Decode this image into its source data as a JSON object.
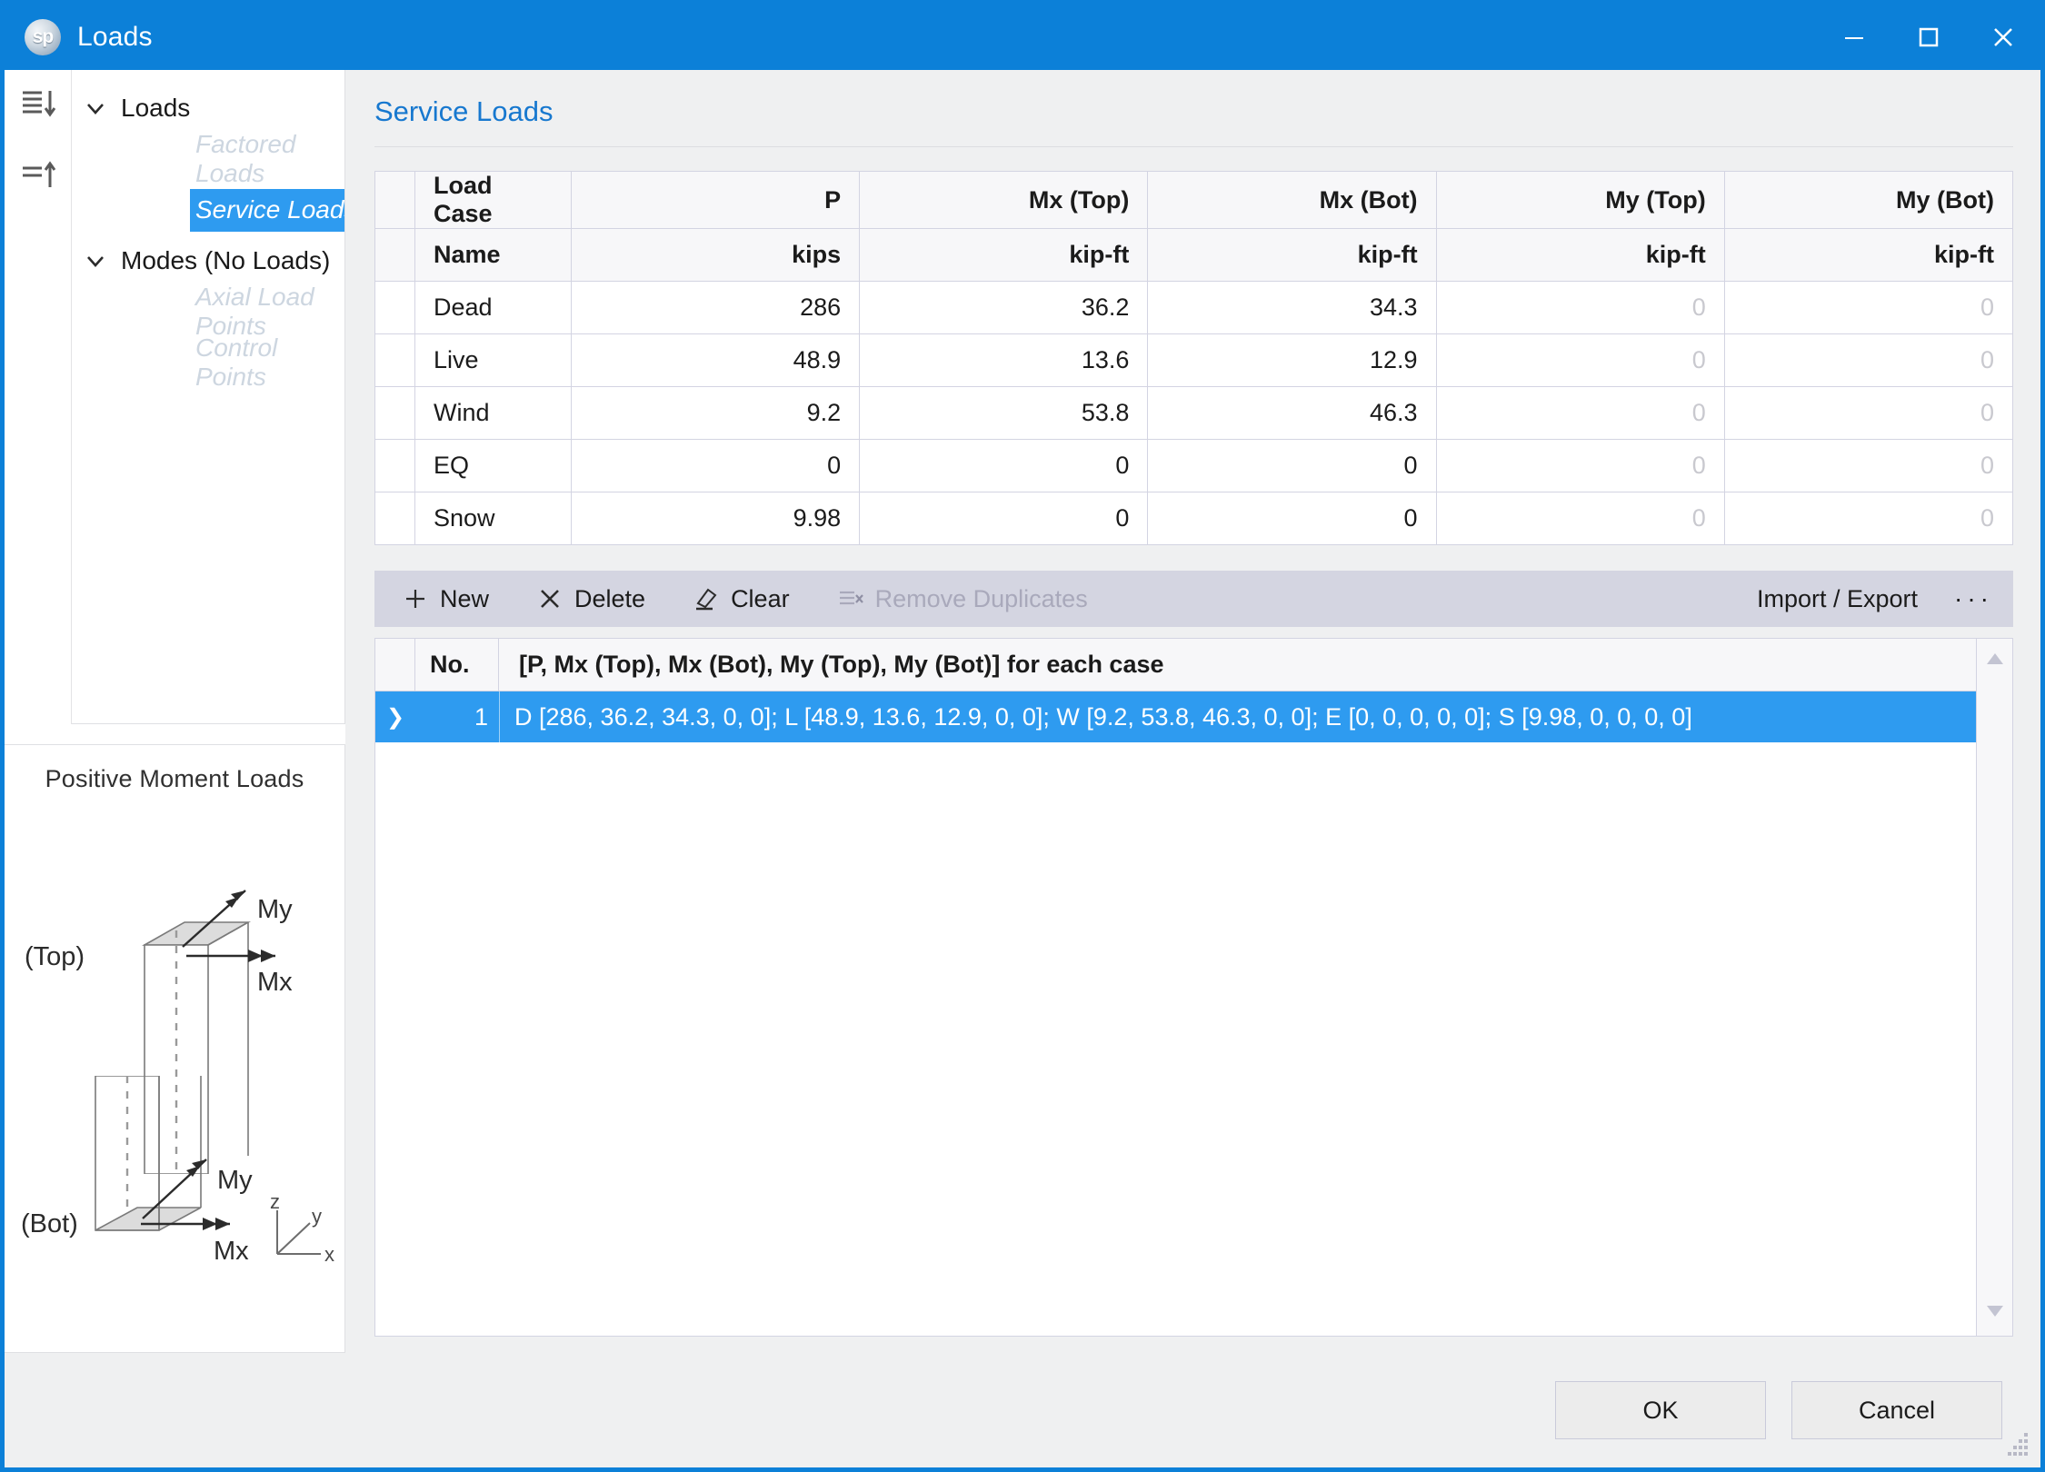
{
  "window": {
    "title": "Loads",
    "logo_text": "sp",
    "controls": {
      "minimize": "minimize-icon",
      "maximize": "maximize-icon",
      "close": "close-icon"
    },
    "accent_color": "#0c80d8",
    "selection_color": "#2e9bf0"
  },
  "sidebar": {
    "gutter": [
      {
        "name": "expand-all-icon"
      },
      {
        "name": "collapse-all-icon"
      }
    ],
    "tree": [
      {
        "label": "Loads",
        "level": 0,
        "expanded": true,
        "selected": false,
        "disabled": false
      },
      {
        "label": "Factored Loads",
        "level": 1,
        "expanded": null,
        "selected": false,
        "disabled": true
      },
      {
        "label": "Service Loads",
        "level": 1,
        "expanded": null,
        "selected": true,
        "disabled": false
      },
      {
        "label": "Modes (No Loads)",
        "level": 0,
        "expanded": true,
        "selected": false,
        "disabled": false
      },
      {
        "label": "Axial Load Points",
        "level": 1,
        "expanded": null,
        "selected": false,
        "disabled": true
      },
      {
        "label": "Control Points",
        "level": 1,
        "expanded": null,
        "selected": false,
        "disabled": true
      }
    ],
    "diagram": {
      "title": "Positive Moment Loads",
      "top_label": "(Top)",
      "bot_label": "(Bot)",
      "top_my": "My",
      "top_mx": "Mx",
      "bot_my": "My",
      "bot_mx": "Mx",
      "axes": {
        "z": "z",
        "y": "y",
        "x": "x"
      }
    }
  },
  "main": {
    "page_title": "Service Loads",
    "table": {
      "headers": [
        "",
        "Load Case",
        "P",
        "Mx (Top)",
        "Mx (Bot)",
        "My (Top)",
        "My (Bot)"
      ],
      "units": [
        "",
        "Name",
        "kips",
        "kip-ft",
        "kip-ft",
        "kip-ft",
        "kip-ft"
      ],
      "rows": [
        {
          "name": "Dead",
          "P": "286",
          "mx_top": "36.2",
          "mx_bot": "34.3",
          "my_top": "0",
          "my_bot": "0"
        },
        {
          "name": "Live",
          "P": "48.9",
          "mx_top": "13.6",
          "mx_bot": "12.9",
          "my_top": "0",
          "my_bot": "0"
        },
        {
          "name": "Wind",
          "P": "9.2",
          "mx_top": "53.8",
          "mx_bot": "46.3",
          "my_top": "0",
          "my_bot": "0"
        },
        {
          "name": "EQ",
          "P": "0",
          "mx_top": "0",
          "mx_bot": "0",
          "my_top": "0",
          "my_bot": "0"
        },
        {
          "name": "Snow",
          "P": "9.98",
          "mx_top": "0",
          "mx_bot": "0",
          "my_top": "0",
          "my_bot": "0"
        }
      ]
    },
    "toolbar": {
      "new": "New",
      "delete": "Delete",
      "clear": "Clear",
      "remove_duplicates": "Remove Duplicates",
      "remove_duplicates_disabled": true,
      "import_export": "Import / Export",
      "overflow": "···"
    },
    "grid": {
      "col_no": "No.",
      "col_desc": "[P, Mx (Top), Mx (Bot), My (Top), My (Bot)] for each case",
      "rows": [
        {
          "indicator": "❯",
          "no": "1",
          "desc": "D [286, 36.2, 34.3, 0, 0]; L [48.9, 13.6, 12.9, 0, 0]; W [9.2, 53.8, 46.3, 0, 0]; E [0, 0, 0, 0, 0]; S [9.98, 0, 0, 0, 0]",
          "selected": true
        }
      ]
    }
  },
  "footer": {
    "ok": "OK",
    "cancel": "Cancel"
  }
}
